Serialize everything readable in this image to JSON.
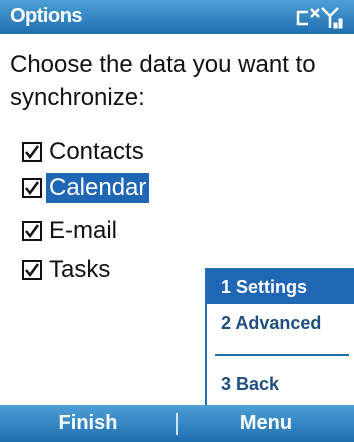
{
  "title_bar": {
    "title": "Options",
    "icons": [
      "sync-disconnected-icon",
      "signal-strength-icon"
    ]
  },
  "instruction": "Choose the data you want to synchronize:",
  "options": [
    {
      "label": "Contacts",
      "checked": true
    },
    {
      "label": "Calendar",
      "checked": true,
      "selected": true
    },
    {
      "label": "E-mail",
      "checked": true
    },
    {
      "label": "Tasks",
      "checked": true
    }
  ],
  "menu": {
    "items": [
      {
        "label": "1 Settings",
        "highlighted": true
      },
      {
        "label": "2 Advanced"
      },
      {
        "label": "3 Back"
      }
    ]
  },
  "softkeys": {
    "left": "Finish",
    "right": "Menu"
  },
  "colors": {
    "accent": "#1f6fb0",
    "selection": "#1f67b5"
  }
}
